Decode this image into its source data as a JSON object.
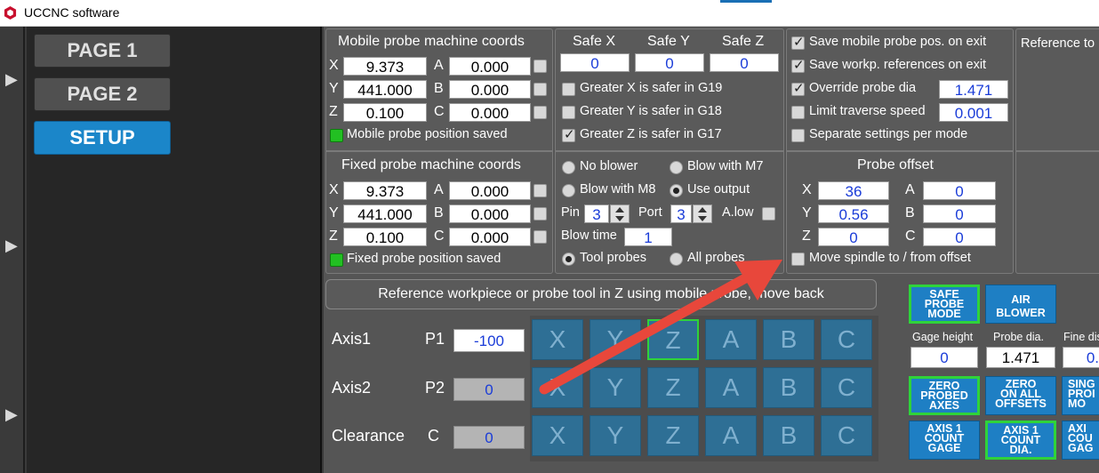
{
  "window": {
    "title": "UCCNC software"
  },
  "nav": {
    "page1": "PAGE 1",
    "page2": "PAGE 2",
    "setup": "SETUP"
  },
  "mobile": {
    "title": "Mobile probe machine coords",
    "x_label": "X",
    "x": "9.373",
    "a_label": "A",
    "a": "0.000",
    "y_label": "Y",
    "y": "441.000",
    "b_label": "B",
    "b": "0.000",
    "z_label": "Z",
    "z": "0.100",
    "c_label": "C",
    "c": "0.000",
    "status": "Mobile probe position saved"
  },
  "fixed": {
    "title": "Fixed probe machine coords",
    "x_label": "X",
    "x": "9.373",
    "a_label": "A",
    "a": "0.000",
    "y_label": "Y",
    "y": "441.000",
    "b_label": "B",
    "b": "0.000",
    "z_label": "Z",
    "z": "0.100",
    "c_label": "C",
    "c": "0.000",
    "status": "Fixed probe position saved"
  },
  "safe": {
    "x_label": "Safe X",
    "y_label": "Safe Y",
    "z_label": "Safe Z",
    "x": "0",
    "y": "0",
    "z": "0",
    "gx": "Greater X is safer in G19",
    "gy": "Greater Y is safer in G18",
    "gz": "Greater Z is safer in G17"
  },
  "blower": {
    "no_blower": "No blower",
    "blow_m7": "Blow with M7",
    "blow_m8": "Blow with M8",
    "use_output": "Use output",
    "pin_label": "Pin",
    "pin": "3",
    "port_label": "Port",
    "port": "3",
    "alow_label": "A.low",
    "blow_time_label": "Blow time",
    "blow_time": "1",
    "tool_probes": "Tool probes",
    "all_probes": "All probes"
  },
  "options": {
    "save_mobile": "Save mobile probe pos. on exit",
    "save_workp": "Save workp. references on exit",
    "override_dia": "Override probe dia",
    "override_dia_value": "1.471",
    "limit_speed": "Limit traverse speed",
    "limit_speed_value": "0.001",
    "separate": "Separate settings per mode"
  },
  "offset": {
    "title": "Probe offset",
    "x_label": "X",
    "x": "36",
    "a_label": "A",
    "a": "0",
    "y_label": "Y",
    "y": "0.56",
    "b_label": "B",
    "b": "0",
    "z_label": "Z",
    "z": "0",
    "c_label": "C",
    "c": "0",
    "move_spindle": "Move spindle to / from offset"
  },
  "reference_cut": "Reference to",
  "refbar": "Reference workpiece or probe tool in Z using mobile probe, move back",
  "axes": {
    "axis1": "Axis1",
    "p1_label": "P1",
    "p1": "-100",
    "axis2": "Axis2",
    "p2_label": "P2",
    "p2": "0",
    "clearance": "Clearance",
    "c_label": "C",
    "c": "0",
    "letters": [
      "X",
      "Y",
      "Z",
      "A",
      "B",
      "C"
    ]
  },
  "buttons": {
    "safe_probe": "SAFE\nPROBE\nMODE",
    "air_blower": "AIR\nBLOWER",
    "zero_probed": "ZERO\nPROBED\nAXES",
    "zero_all": "ZERO\nON ALL\nOFFSETS",
    "single_cut": "SING\nPROI\nMO",
    "axis1_gage": "AXIS 1\nCOUNT\nGAGE",
    "axis1_dia": "AXIS 1\nCOUNT\nDIA.",
    "axi_cut": "AXI\nCOU\nGAG"
  },
  "gage": {
    "height_label": "Gage height",
    "height": "0",
    "probe_dia_label": "Probe dia.",
    "probe_dia": "1.471",
    "fine_label": "Fine dis",
    "fine": "0."
  },
  "colors": {
    "accent": "#1b86c9",
    "selected": "#2fd33a",
    "arrow": "#e8473b"
  }
}
